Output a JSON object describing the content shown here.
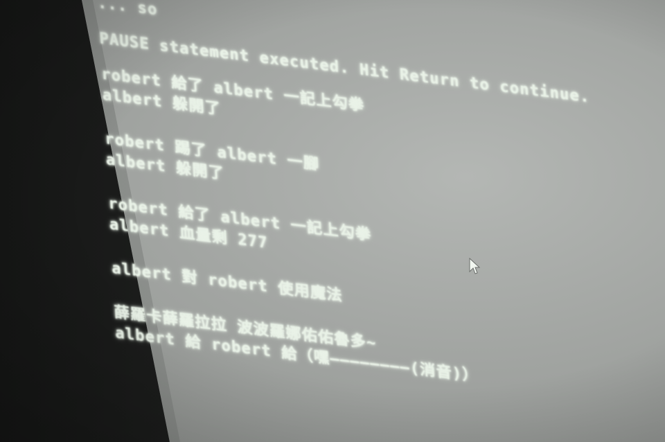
{
  "console": {
    "top_fragment": "... so",
    "pause_message": "PAUSE statement executed. Hit Return to continue.",
    "block1": {
      "line1": "robert 給了 albert 一記上勾拳",
      "line2": "albert 躲開了"
    },
    "block2": {
      "line1": "robert 踢了 albert 一腳",
      "line2": "albert 躲開了"
    },
    "block3": {
      "line1": "robert 給了 albert 一記上勾拳",
      "line2": "albert 血量剩 277"
    },
    "block4": {
      "line1": "albert 對 robert 使用魔法"
    },
    "block5": {
      "line1": "薛羅卡薛羅拉拉 波波羅娜佑佑魯多~",
      "line2": "albert 給 robert 給（嘿————————(消音)）"
    }
  },
  "colors": {
    "screen": "#a3a6a3",
    "wall": "#1e1f1e",
    "text": "#e9f2e7"
  },
  "icons": {
    "cursor": "mouse-pointer-icon"
  }
}
